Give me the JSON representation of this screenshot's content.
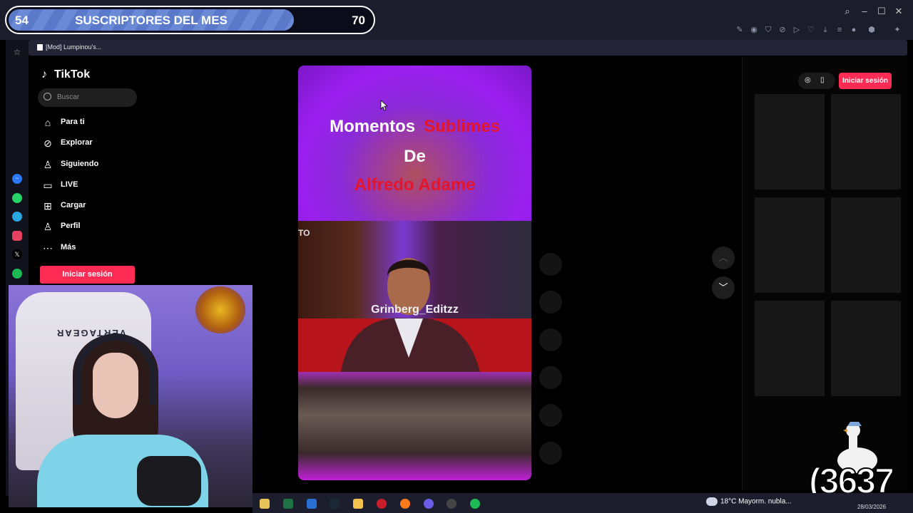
{
  "subscriber_goal": {
    "current": "54",
    "title": "SUSCRIPTORES DEL MES",
    "target": "70"
  },
  "browser": {
    "tab_title": "[Mod] Lumpinou's..."
  },
  "tiktok": {
    "logo": "TikTok",
    "search_placeholder": "Buscar",
    "nav": [
      {
        "label": "Para ti",
        "icon": "home-icon"
      },
      {
        "label": "Explorar",
        "icon": "compass-icon"
      },
      {
        "label": "Siguiendo",
        "icon": "following-icon"
      },
      {
        "label": "LIVE",
        "icon": "live-icon"
      },
      {
        "label": "Cargar",
        "icon": "upload-icon"
      },
      {
        "label": "Perfil",
        "icon": "profile-icon"
      },
      {
        "label": "Más",
        "icon": "more-icon"
      }
    ],
    "login_button": "Iniciar sesión",
    "login_button_top": "Iniciar sesión"
  },
  "video": {
    "caption_word1": "Momentos",
    "caption_word2": "Sublimes",
    "caption_line2": "De",
    "caption_line3": "Alfredo Adame",
    "partial_text": "TO",
    "watermark": "Grinberg_Editzz"
  },
  "webcam": {
    "chair_brand": "VERTAGEAR"
  },
  "overlay": {
    "counter": "(3637"
  },
  "taskbar": {
    "weather": "18°C  Mayorm. nubla...",
    "date": "28/03/2026"
  },
  "colors": {
    "tiktok_pink": "#fe2c55",
    "caption_red": "#e4152a",
    "sub_bar": "#5a79c8"
  }
}
